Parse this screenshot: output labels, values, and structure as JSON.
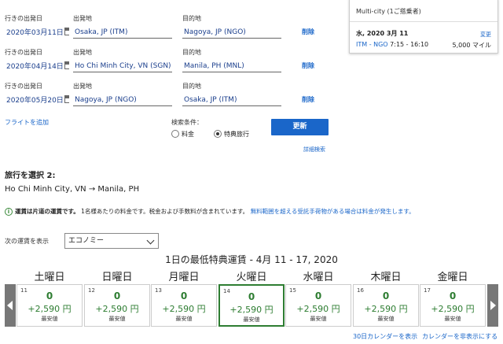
{
  "flights": [
    {
      "date_label": "行きの出発日",
      "date": "2020年03月11日",
      "from_label": "出発地",
      "from": "Osaka, JP (ITM)",
      "to_label": "目的地",
      "to": "Nagoya, JP (NGO)",
      "delete": "削除"
    },
    {
      "date_label": "行きの出発日",
      "date": "2020年04月14日",
      "from_label": "出発地",
      "from": "Ho Chi Minh City, VN (SGN)",
      "to_label": "目的地",
      "to": "Manila, PH (MNL)",
      "delete": "削除"
    },
    {
      "date_label": "行きの出発日",
      "date": "2020年05月20日",
      "from_label": "出発地",
      "from": "Nagoya, JP (NGO)",
      "to_label": "目的地",
      "to": "Osaka, JP (ITM)",
      "delete": "削除"
    }
  ],
  "add_flight": "フライトを追加",
  "search": {
    "conditions_label": "検索条件：",
    "option_fare": "料金",
    "option_award": "特典旅行",
    "update_button": "更新",
    "advanced": "詳細検索"
  },
  "summary": {
    "title": "Multi-city (1ご搭乗者)",
    "date": "水, 2020 3月 11",
    "change": "変更",
    "route": "ITM - NGO",
    "time": "7:15 - 16:10",
    "miles": "5,000 マイル"
  },
  "select_trip": {
    "heading": "旅行を選択 2:",
    "origin": "Ho Chi Minh City, VN",
    "arrow": "→",
    "destination": "Manila, PH"
  },
  "notice": {
    "bold": "運賃は片道の運賃です。",
    "text": "1名様あたりの料金です。税金および手数料が含まれています。",
    "link": "無料範囲を超える受託手荷物がある場合は料金が発生します。"
  },
  "cabin": {
    "label": "次の運賃を表示",
    "selected": "エコノミー"
  },
  "calendar": {
    "title": "1日の最低特典運賃 - 4月 11 - 17, 2020",
    "days": [
      {
        "dow": "土曜日",
        "num": "11",
        "miles": "0",
        "fee": "+2,590 円",
        "tag": "最安値"
      },
      {
        "dow": "日曜日",
        "num": "12",
        "miles": "0",
        "fee": "+2,590 円",
        "tag": "最安値"
      },
      {
        "dow": "月曜日",
        "num": "13",
        "miles": "0",
        "fee": "+2,590 円",
        "tag": "最安値"
      },
      {
        "dow": "火曜日",
        "num": "14",
        "miles": "0",
        "fee": "+2,590 円",
        "tag": "最安値"
      },
      {
        "dow": "水曜日",
        "num": "15",
        "miles": "0",
        "fee": "+2,590 円",
        "tag": "最安値"
      },
      {
        "dow": "木曜日",
        "num": "16",
        "miles": "0",
        "fee": "+2,590 円",
        "tag": "最安値"
      },
      {
        "dow": "金曜日",
        "num": "17",
        "miles": "0",
        "fee": "+2,590 円",
        "tag": "最安値"
      }
    ],
    "link_30day": "30日カレンダーを表示",
    "link_hide": "カレンダーを非表示にする"
  }
}
